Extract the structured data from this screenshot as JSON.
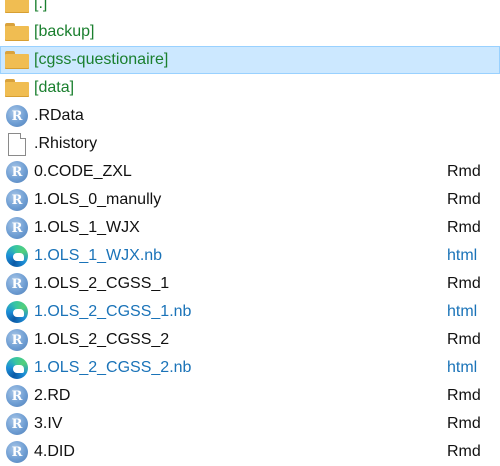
{
  "files": [
    {
      "name": "[.]",
      "ext": "",
      "icon": "folder-icon",
      "kind": "dir",
      "selected": false
    },
    {
      "name": "[backup]",
      "ext": "",
      "icon": "folder-icon",
      "kind": "dir",
      "selected": false
    },
    {
      "name": "[cgss-questionaire]",
      "ext": "",
      "icon": "folder-icon",
      "kind": "dir",
      "selected": true
    },
    {
      "name": "[data]",
      "ext": "",
      "icon": "folder-icon",
      "kind": "dir",
      "selected": false
    },
    {
      "name": ".RData",
      "ext": "",
      "icon": "r-icon",
      "kind": "file",
      "selected": false
    },
    {
      "name": ".Rhistory",
      "ext": "",
      "icon": "blank-file-icon",
      "kind": "file",
      "selected": false
    },
    {
      "name": "0.CODE_ZXL",
      "ext": "Rmd",
      "icon": "r-icon",
      "kind": "file",
      "selected": false
    },
    {
      "name": "1.OLS_0_manully",
      "ext": "Rmd",
      "icon": "r-icon",
      "kind": "file",
      "selected": false
    },
    {
      "name": "1.OLS_1_WJX",
      "ext": "Rmd",
      "icon": "r-icon",
      "kind": "file",
      "selected": false
    },
    {
      "name": "1.OLS_1_WJX.nb",
      "ext": "html",
      "icon": "edge-icon",
      "kind": "html",
      "selected": false
    },
    {
      "name": "1.OLS_2_CGSS_1",
      "ext": "Rmd",
      "icon": "r-icon",
      "kind": "file",
      "selected": false
    },
    {
      "name": "1.OLS_2_CGSS_1.nb",
      "ext": "html",
      "icon": "edge-icon",
      "kind": "html",
      "selected": false
    },
    {
      "name": "1.OLS_2_CGSS_2",
      "ext": "Rmd",
      "icon": "r-icon",
      "kind": "file",
      "selected": false
    },
    {
      "name": "1.OLS_2_CGSS_2.nb",
      "ext": "html",
      "icon": "edge-icon",
      "kind": "html",
      "selected": false
    },
    {
      "name": "2.RD",
      "ext": "Rmd",
      "icon": "r-icon",
      "kind": "file",
      "selected": false
    },
    {
      "name": "3.IV",
      "ext": "Rmd",
      "icon": "r-icon",
      "kind": "file",
      "selected": false
    },
    {
      "name": "4.DID",
      "ext": "Rmd",
      "icon": "r-icon",
      "kind": "file",
      "selected": false
    }
  ],
  "colors": {
    "folder_text": "#1a7f2e",
    "html_text": "#1a73b8",
    "selection_bg": "#cce8ff",
    "selection_border": "#99d1ff"
  }
}
